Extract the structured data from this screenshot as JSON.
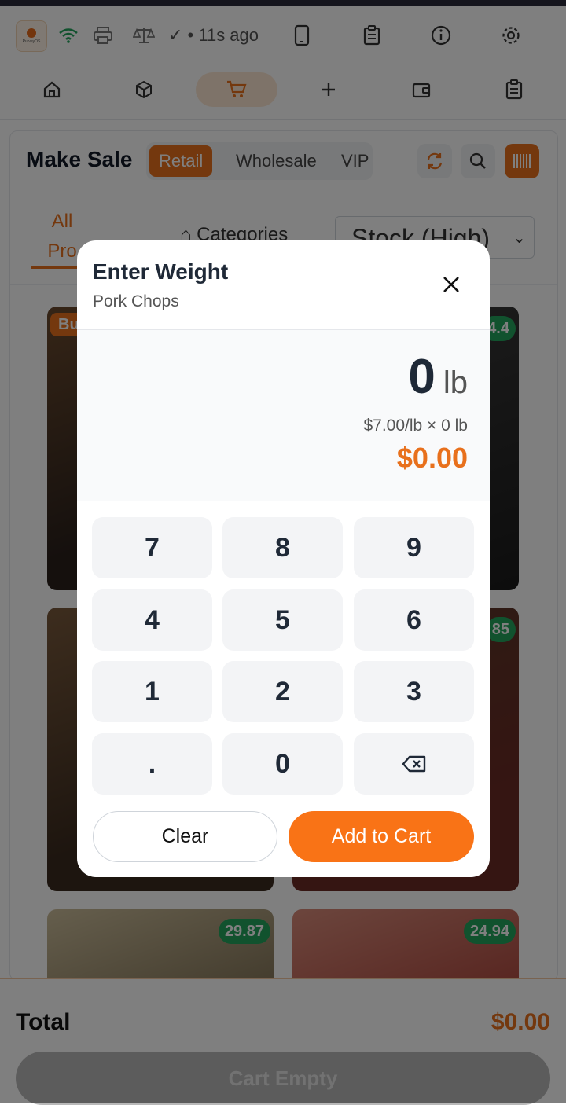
{
  "app": {
    "logo_text": "PurveyOS"
  },
  "status_bar": {
    "sync_text": "• 11s ago"
  },
  "header": {
    "title": "Make Sale",
    "modes": [
      "Retail",
      "Wholesale",
      "VIP"
    ],
    "active_mode": "Retail"
  },
  "filters": {
    "tab_all": "All\nPro",
    "categories_label": "Categories",
    "sort_value": "Stock (High)"
  },
  "products": [
    {
      "tag": "Bu",
      "badge": "4.4"
    },
    {
      "badge": "85"
    },
    {
      "badge": "29.87"
    },
    {
      "badge": "24.94"
    }
  ],
  "footer": {
    "total_label": "Total",
    "total_value": "$0.00",
    "cart_button": "Cart Empty"
  },
  "modal": {
    "title": "Enter Weight",
    "subtitle": "Pork Chops",
    "weight_value": "0",
    "weight_unit": "lb",
    "calc_text": "$7.00/lb × 0 lb",
    "price": "$0.00",
    "keys": [
      "7",
      "8",
      "9",
      "4",
      "5",
      "6",
      "1",
      "2",
      "3",
      ".",
      "0"
    ],
    "clear_label": "Clear",
    "add_label": "Add to Cart"
  },
  "colors": {
    "accent": "#f97316",
    "accent_dark": "#e8701c",
    "badge_green": "#22a45d"
  }
}
